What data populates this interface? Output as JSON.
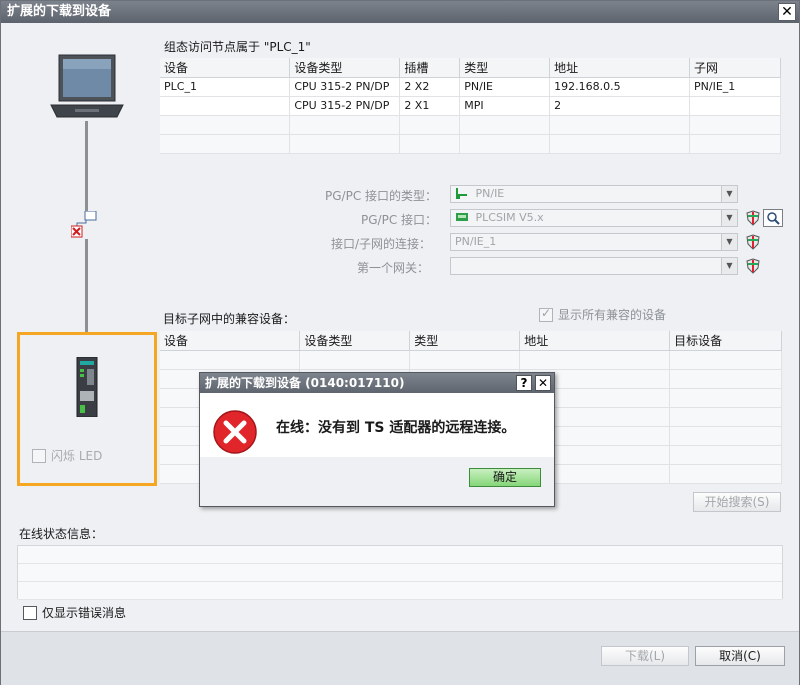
{
  "window": {
    "title": "扩展的下载到设备",
    "close_glyph": "✕"
  },
  "access_nodes": {
    "label": "组态访问节点属于 \"PLC_1\"",
    "columns": [
      "设备",
      "设备类型",
      "插槽",
      "类型",
      "地址",
      "子网"
    ],
    "rows": [
      [
        "PLC_1",
        "CPU 315-2 PN/DP",
        "2 X2",
        "PN/IE",
        "192.168.0.5",
        "PN/IE_1"
      ],
      [
        "",
        "CPU 315-2 PN/DP",
        "2 X1",
        "MPI",
        "2",
        ""
      ]
    ]
  },
  "interface": {
    "pgpc_type_label": "PG/PC 接口的类型：",
    "pgpc_type_value": "PN/IE",
    "pgpc_if_label": "PG/PC 接口：",
    "pgpc_if_value": "PLCSIM V5.x",
    "subnet_conn_label": "接口/子网的连接：",
    "subnet_conn_value": "PN/IE_1",
    "gateway_label": "第一个网关：",
    "gateway_value": ""
  },
  "compatible": {
    "label": "目标子网中的兼容设备：",
    "show_all_label": "显示所有兼容的设备",
    "columns": [
      "设备",
      "设备类型",
      "类型",
      "地址",
      "目标设备"
    ]
  },
  "device_panel": {
    "flash_led_label": "闪烁 LED"
  },
  "search_button": "开始搜索(S)",
  "status": {
    "label": "在线状态信息：",
    "only_errors_label": "仅显示错误消息"
  },
  "footer": {
    "download_button": "下载(L)",
    "cancel_button": "取消(C)"
  },
  "dialog": {
    "title": "扩展的下载到设备 (0140:017110)",
    "help_glyph": "?",
    "close_glyph": "✕",
    "message": "在线：没有到 TS 适配器的远程连接。",
    "ok_button": "确定"
  },
  "colors": {
    "accent_orange": "#f5a623",
    "error_red": "#e0262b",
    "ok_green": "#86d67a"
  }
}
